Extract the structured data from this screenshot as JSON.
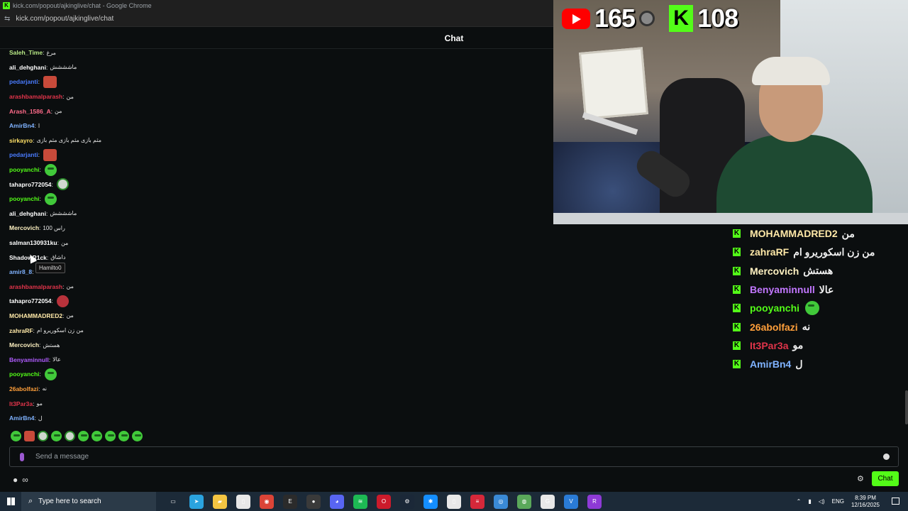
{
  "browser": {
    "window_title": "kick.com/popout/ajkinglive/chat - Google Chrome",
    "url": "kick.com/popout/ajkinglive/chat",
    "favicon": "K"
  },
  "chat": {
    "header_title": "Chat",
    "messages": [
      {
        "user": "Saleh_Time",
        "color": "#b8e986",
        "text": "مرغ",
        "emote": null
      },
      {
        "user": "ali_dehghani",
        "color": "#ffffff",
        "text": "ماشششش",
        "emote": null
      },
      {
        "user": "pedarjanti",
        "color": "#4a7cff",
        "text": "",
        "emote": "face"
      },
      {
        "user": "arashbamalparash",
        "color": "#e0344a",
        "text": "من",
        "emote": null
      },
      {
        "user": "Arash_1586_A",
        "color": "#ff6b8a",
        "text": "من",
        "emote": null
      },
      {
        "user": "AmirBn4",
        "color": "#7fb2ff",
        "text": "ا",
        "emote": null
      },
      {
        "user": "sirkayro",
        "color": "#ffe066",
        "text": "مثم بازی مثم بازی مثم بازی",
        "emote": null
      },
      {
        "user": "pedarjanti",
        "color": "#4a7cff",
        "text": "",
        "emote": "face"
      },
      {
        "user": "pooyanchi",
        "color": "#53fc18",
        "text": "",
        "emote": "green"
      },
      {
        "user": "tahapro772054",
        "color": "#ffffff",
        "text": "",
        "emote": "grey"
      },
      {
        "user": "pooyanchi",
        "color": "#53fc18",
        "text": "",
        "emote": "green"
      },
      {
        "user": "ali_dehghani",
        "color": "#ffffff",
        "text": "ماشششش",
        "emote": null
      },
      {
        "user": "Mercovich",
        "color": "#fff2c2",
        "text": "راس 100",
        "emote": null
      },
      {
        "user": "salman130931ku",
        "color": "#ffffff",
        "text": "من",
        "emote": null
      },
      {
        "user": "ShadowR1ck",
        "color": "#ffffff",
        "text": "داشاق",
        "emote": null
      },
      {
        "user": "amir8_8",
        "color": "#7fb2ff",
        "text": "",
        "emote": null
      },
      {
        "user": "arashbamalparash",
        "color": "#e0344a",
        "text": "من",
        "emote": null
      },
      {
        "user": "tahapro772054",
        "color": "#ffffff",
        "text": "",
        "emote": "red"
      },
      {
        "user": "MOHAMMADRED2",
        "color": "#ffe9a8",
        "text": "من",
        "emote": null
      },
      {
        "user": "zahraRF",
        "color": "#ffe9a8",
        "text": "من زن اسکوریرو ام",
        "emote": null
      },
      {
        "user": "Mercovich",
        "color": "#fff2c2",
        "text": "هستش",
        "emote": null
      },
      {
        "user": "Benyaminnull",
        "color": "#b05cff",
        "text": "عالا",
        "emote": null
      },
      {
        "user": "pooyanchi",
        "color": "#53fc18",
        "text": "",
        "emote": "green"
      },
      {
        "user": "26abolfazi",
        "color": "#ff9f3a",
        "text": "نه",
        "emote": null
      },
      {
        "user": "It3Par3a",
        "color": "#e0344a",
        "text": "مو",
        "emote": null
      },
      {
        "user": "AmirBn4",
        "color": "#7fb2ff",
        "text": "ل",
        "emote": null
      }
    ],
    "tooltip": "Hamilto0",
    "input_placeholder": "Send a message",
    "chat_button": "Chat",
    "bottom_left": "∞"
  },
  "stream_overlay": {
    "youtube_count": "165",
    "kick_count": "108",
    "kick_letter": "K",
    "messages": [
      {
        "user": "MOHAMMADRED2",
        "color": "#ffe9a8",
        "text": "من",
        "emote": null
      },
      {
        "user": "zahraRF",
        "color": "#ffe9a8",
        "text": "من زن اسکوریرو ام",
        "emote": null
      },
      {
        "user": "Mercovich",
        "color": "#fff2c2",
        "text": "هستش",
        "emote": null
      },
      {
        "user": "Benyaminnull",
        "color": "#c277ff",
        "text": "عالا",
        "emote": null
      },
      {
        "user": "pooyanchi",
        "color": "#53fc18",
        "text": "",
        "emote": "green"
      },
      {
        "user": "26abolfazi",
        "color": "#ff9f3a",
        "text": "نه",
        "emote": null
      },
      {
        "user": "It3Par3a",
        "color": "#e0344a",
        "text": "مو",
        "emote": null
      },
      {
        "user": "AmirBn4",
        "color": "#7fb2ff",
        "text": "ل",
        "emote": null
      }
    ]
  },
  "taskbar": {
    "search_placeholder": "Type here to search",
    "language": "ENG",
    "time": "8:39 PM",
    "date": "12/16/2025",
    "apps": [
      {
        "name": "task-view-icon",
        "color": "#1c2a38",
        "glyph": "▭"
      },
      {
        "name": "telegram-icon",
        "color": "#2aa3df",
        "glyph": "➤"
      },
      {
        "name": "file-explorer-icon",
        "color": "#f4c542",
        "glyph": "▰"
      },
      {
        "name": "notepad-icon",
        "color": "#e8e8e8",
        "glyph": "▯"
      },
      {
        "name": "chrome-icon",
        "color": "#db4437",
        "glyph": "◉"
      },
      {
        "name": "epic-games-icon",
        "color": "#2b2b2b",
        "glyph": "E"
      },
      {
        "name": "obs-icon",
        "color": "#3a3a3a",
        "glyph": "●"
      },
      {
        "name": "discord-icon",
        "color": "#5865f2",
        "glyph": "◕"
      },
      {
        "name": "spotify-icon",
        "color": "#1db954",
        "glyph": "≋"
      },
      {
        "name": "opera-icon",
        "color": "#cc1b2b",
        "glyph": "O"
      },
      {
        "name": "steam-icon",
        "color": "#1b2838",
        "glyph": "⚙"
      },
      {
        "name": "battlenet-icon",
        "color": "#148eff",
        "glyph": "✱"
      },
      {
        "name": "document-icon",
        "color": "#e8e8e8",
        "glyph": "▯"
      },
      {
        "name": "flash-icon",
        "color": "#d6283a",
        "glyph": "≡"
      },
      {
        "name": "vpn-icon",
        "color": "#3a8ad6",
        "glyph": "◎"
      },
      {
        "name": "earth-icon",
        "color": "#5aa85a",
        "glyph": "◍"
      },
      {
        "name": "ghub-icon",
        "color": "#e8e8e8",
        "glyph": "G"
      },
      {
        "name": "vscode-icon",
        "color": "#2a7bd6",
        "glyph": "V"
      },
      {
        "name": "r-app-icon",
        "color": "#8e3ad6",
        "glyph": "R"
      }
    ]
  }
}
